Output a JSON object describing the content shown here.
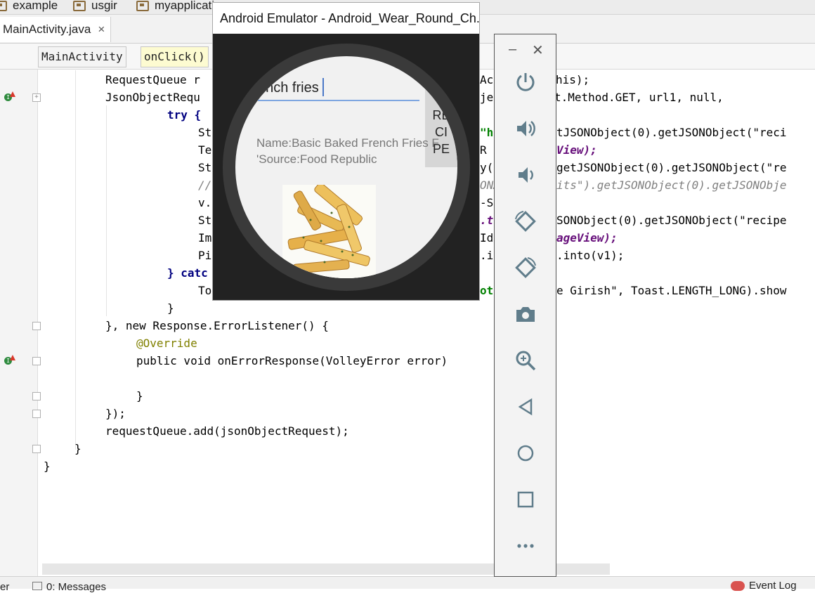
{
  "breadcrumb": {
    "items": [
      "example",
      "usgir",
      "myapplicati..."
    ]
  },
  "editor": {
    "tab_label": "MainActivity.java",
    "tab_close": "×",
    "structure": [
      "MainActivity",
      "onClick()"
    ]
  },
  "code": {
    "lines": [
      "RequestQueue r",
      "JsonObjectRequ",
      "try {",
      "St",
      "Te",
      "St",
      "//",
      "v.",
      "St",
      "Im",
      "Pi",
      "} catc",
      "To",
      "}",
      "}, new Response.ErrorListener() {",
      "@Override",
      "public void onErrorResponse(VolleyError error)",
      "}",
      "});",
      "requestQueue.add(jsonObjectRequest);",
      "}",
      "}"
    ],
    "right_fragments": {
      "l0": "Act",
      "l0b": "his);",
      "l1": "ject(Request.Method.GET, url1, null,",
      "l3a": "\"hi",
      "l3b": "tJSONObject(0).getJSONObject(\"reci",
      "l4a": "R",
      "l4b": "View);",
      "l5a": "y(\"",
      "l5b": "getJSONObject(0).getJSONObject(\"re",
      "l6a": "ONA",
      "l6b": "its\").getJSONObject(0).getJSONObje",
      "l7": "-Sc",
      "l8a": ".ts",
      "l8b": "SONObject(0).getJSONObject(\"recipe",
      "l9a": "Id",
      "l9b": "ageView);",
      "l10a": ".i",
      "l10b": ".into(v1);",
      "l12a": "ot",
      "l12b": "e Girish\", Toast.LENGTH_LONG).show"
    }
  },
  "emulator": {
    "title": "Android Emulator - Android_Wear_Round_Ch...",
    "input_value": "ench fries",
    "button_label_lines": [
      "T",
      "RE",
      "CI",
      "PE"
    ],
    "result_line1": "Name:Basic Baked French Fries F",
    "result_line2": "'Source:Food Republic",
    "image_subject": "french fries"
  },
  "panel": {
    "minimize": "–",
    "close": "✕",
    "buttons": [
      "power-icon",
      "volume-up-icon",
      "volume-down-icon",
      "rotate-left-icon",
      "rotate-right-icon",
      "camera-icon",
      "zoom-icon",
      "back-icon",
      "home-icon",
      "overview-icon",
      "more-icon"
    ]
  },
  "status": {
    "messages": "0: Messages",
    "event_log": "Event Log",
    "left_fragment": "er"
  }
}
